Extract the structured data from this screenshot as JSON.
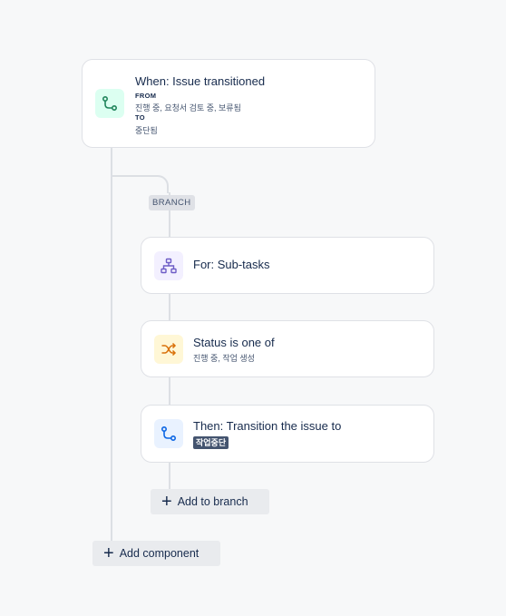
{
  "trigger": {
    "title": "When: Issue transitioned",
    "from_label": "FROM",
    "from_value": "진행 중, 요청서 검토 중, 보류됨",
    "to_label": "TO",
    "to_value": "중단됨"
  },
  "branch": {
    "tag": "BRANCH",
    "for_title": "For: Sub-tasks",
    "condition_title": "Status is one of",
    "condition_value": "진행 중, 작업 생성",
    "action_title": "Then: Transition the issue to",
    "action_status": "작업중단",
    "add_to_branch": "Add to branch"
  },
  "add_component": "Add component",
  "colors": {
    "trigger_icon_bg": "#dcfff1",
    "trigger_icon": "#1f845a",
    "branch_icon_bg": "#f3f0ff",
    "branch_icon": "#6e5dc6",
    "condition_icon_bg": "#fff7d6",
    "condition_icon": "#d97008",
    "action_icon_bg": "#e9f2ff",
    "action_icon": "#0c66e4"
  }
}
